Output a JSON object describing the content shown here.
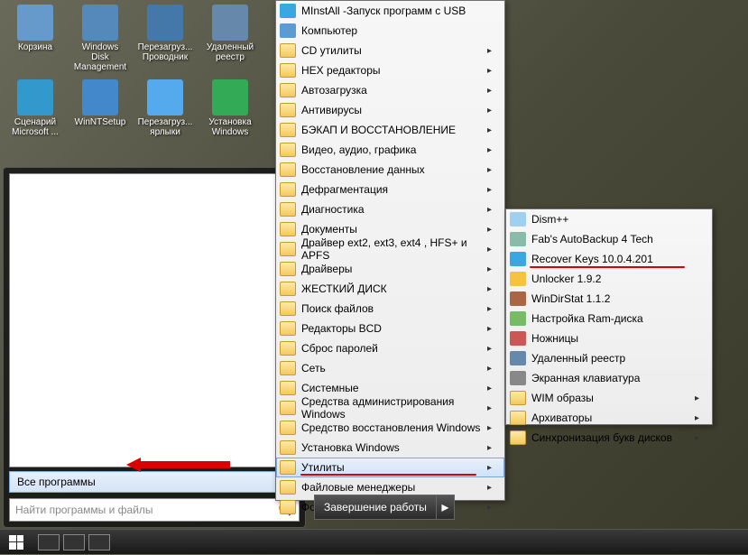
{
  "desktop_icons": [
    {
      "label": "Корзина",
      "color": "#6699cc"
    },
    {
      "label": "Windows Disk Management",
      "color": "#5588bb"
    },
    {
      "label": "Перезагруз... Проводник",
      "color": "#4477aa"
    },
    {
      "label": "Удаленный реестр",
      "color": "#6688aa"
    },
    {
      "label": "Сценарий Microsoft ...",
      "color": "#3399cc"
    },
    {
      "label": "WinNTSetup",
      "color": "#4488cc"
    },
    {
      "label": "Перезагруз... ярлыки",
      "color": "#55aaee"
    },
    {
      "label": "Установка Windows",
      "color": "#33aa55"
    }
  ],
  "all_programs_label": "Все программы",
  "search_placeholder": "Найти программы и файлы",
  "shutdown_label": "Завершение работы",
  "menu1": [
    {
      "label": "MInstAll -Запуск программ с USB",
      "type": "app",
      "color": "#3ba7e0"
    },
    {
      "label": "Компьютер",
      "type": "app",
      "color": "#5a9bd4"
    },
    {
      "label": "CD утилиты",
      "type": "folder",
      "sub": true
    },
    {
      "label": "HEX редакторы",
      "type": "folder",
      "sub": true
    },
    {
      "label": "Автозагрузка",
      "type": "folder",
      "sub": true
    },
    {
      "label": "Антивирусы",
      "type": "folder",
      "sub": true
    },
    {
      "label": "БЭКАП И ВОССТАНОВЛЕНИЕ",
      "type": "folder",
      "sub": true
    },
    {
      "label": "Видео, аудио, графика",
      "type": "folder",
      "sub": true
    },
    {
      "label": "Восстановление данных",
      "type": "folder",
      "sub": true
    },
    {
      "label": "Дефрагментация",
      "type": "folder",
      "sub": true
    },
    {
      "label": "Диагностика",
      "type": "folder",
      "sub": true
    },
    {
      "label": "Документы",
      "type": "folder",
      "sub": true
    },
    {
      "label": "Драйвер ext2, ext3, ext4 , HFS+ и APFS",
      "type": "folder",
      "sub": true
    },
    {
      "label": "Драйверы",
      "type": "folder",
      "sub": true
    },
    {
      "label": "ЖЕСТКИЙ ДИСК",
      "type": "folder",
      "sub": true
    },
    {
      "label": "Поиск файлов",
      "type": "folder",
      "sub": true
    },
    {
      "label": "Редакторы BCD",
      "type": "folder",
      "sub": true
    },
    {
      "label": "Сброс паролей",
      "type": "folder",
      "sub": true
    },
    {
      "label": "Сеть",
      "type": "folder",
      "sub": true
    },
    {
      "label": "Системные",
      "type": "folder",
      "sub": true
    },
    {
      "label": "Средства администрирования Windows",
      "type": "folder",
      "sub": true
    },
    {
      "label": "Средство восстановления Windows",
      "type": "folder",
      "sub": true
    },
    {
      "label": "Установка Windows",
      "type": "folder",
      "sub": true
    },
    {
      "label": "Утилиты",
      "type": "folder",
      "sub": true,
      "selected": true,
      "underline": true
    },
    {
      "label": "Файловые менеджеры",
      "type": "folder",
      "sub": true
    },
    {
      "label": "Форматирование",
      "type": "folder",
      "sub": true
    }
  ],
  "menu2": [
    {
      "label": "Dism++",
      "type": "app",
      "color": "#a0d0f0"
    },
    {
      "label": "Fab's AutoBackup 4 Tech",
      "type": "app",
      "color": "#88bbaa"
    },
    {
      "label": "Recover Keys 10.0.4.201",
      "type": "app",
      "color": "#3ba7e0",
      "underline": true
    },
    {
      "label": "Unlocker 1.9.2",
      "type": "app",
      "color": "#f5c242"
    },
    {
      "label": "WinDirStat 1.1.2",
      "type": "app",
      "color": "#aa6644"
    },
    {
      "label": "Настройка Ram-диска",
      "type": "app",
      "color": "#77bb66"
    },
    {
      "label": "Ножницы",
      "type": "app",
      "color": "#cc5555"
    },
    {
      "label": "Удаленный реестр",
      "type": "app",
      "color": "#6688aa"
    },
    {
      "label": "Экранная клавиатура",
      "type": "app",
      "color": "#888888"
    },
    {
      "label": "WIM образы",
      "type": "folder",
      "sub": true
    },
    {
      "label": "Архиваторы",
      "type": "folder",
      "sub": true
    },
    {
      "label": "Синхронизация букв дисков",
      "type": "folder",
      "sub": true
    }
  ]
}
